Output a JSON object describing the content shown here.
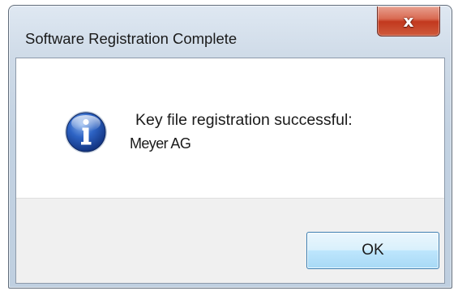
{
  "dialog": {
    "title": "Software Registration Complete",
    "close_symbol": "x",
    "icon": "information-icon",
    "message_line1": "Key file registration successful:",
    "message_line2": "Meyer AG",
    "ok_label": "OK"
  },
  "colors": {
    "close_button_red": "#c7432a",
    "ok_button_border": "#3c7fb1",
    "info_icon_blue": "#1c4fa8",
    "button_area_bg": "#f0f0f0"
  }
}
